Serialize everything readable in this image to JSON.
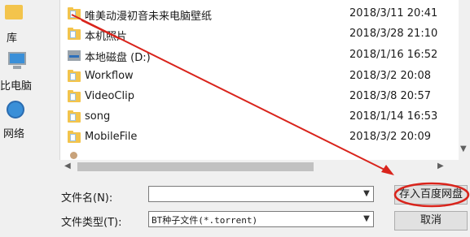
{
  "nav": {
    "library_label": "库",
    "this_pc_label": "比电脑",
    "network_label": "网络"
  },
  "files": [
    {
      "name": "唯美动漫初音未来电脑壁纸",
      "date": "2018/3/11 20:41",
      "icon": "folder-icon"
    },
    {
      "name": "本机照片",
      "date": "2018/3/28 21:10",
      "icon": "folder-icon"
    },
    {
      "name": "本地磁盘 (D:)",
      "date": "2018/1/16 16:52",
      "icon": "drive-icon"
    },
    {
      "name": "Workflow",
      "date": "2018/3/2 20:08",
      "icon": "folder-icon"
    },
    {
      "name": "VideoClip",
      "date": "2018/3/8 20:57",
      "icon": "folder-icon"
    },
    {
      "name": "song",
      "date": "2018/1/14 16:53",
      "icon": "folder-icon"
    },
    {
      "name": "MobileFile",
      "date": "2018/3/2 20:09",
      "icon": "folder-icon"
    }
  ],
  "form": {
    "filename_label": "文件名(N):",
    "filename_value": "",
    "filetype_label": "文件类型(T):",
    "filetype_value": "BT种子文件(*.torrent)"
  },
  "buttons": {
    "save_label": "存入百度网盘",
    "cancel_label": "取消"
  },
  "colors": {
    "annotation": "#d9241c"
  }
}
